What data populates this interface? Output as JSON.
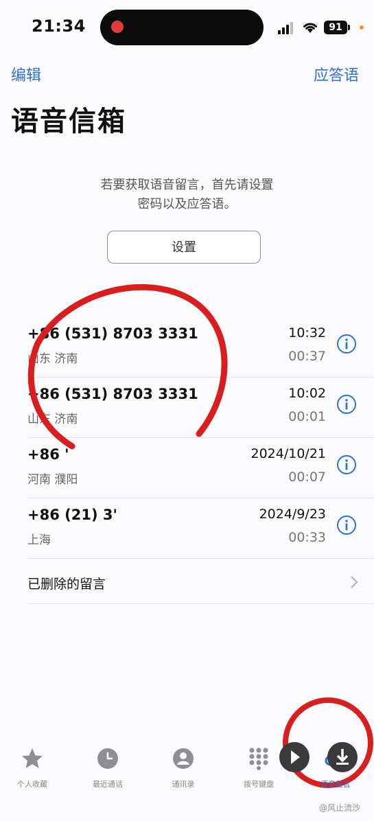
{
  "status": {
    "time": "21:34",
    "battery": "91"
  },
  "nav": {
    "edit": "编辑",
    "greeting": "应答语"
  },
  "title": "语音信箱",
  "prompt": {
    "line1": "若要获取语音留言，首先请设置",
    "line2": "密码以及应答语。"
  },
  "setup_button": "设置",
  "voicemails": [
    {
      "number": "+86 (531) 8703 3331",
      "location": "山东 济南",
      "time": "10:32",
      "duration": "00:37"
    },
    {
      "number": "+86 (531) 8703 3331",
      "location": "山东 济南",
      "time": "10:02",
      "duration": "00:01"
    },
    {
      "number": "+86 '",
      "location": "河南 濮阳",
      "time": "2024/10/21",
      "duration": "00:07"
    },
    {
      "number": "+86 (21) 3'",
      "location": "上海",
      "time": "2024/9/23",
      "duration": "00:33"
    }
  ],
  "deleted_label": "已删除的留言",
  "tabs": [
    {
      "label": "个人收藏",
      "icon": "star-icon"
    },
    {
      "label": "最近通话",
      "icon": "clock-icon"
    },
    {
      "label": "通讯录",
      "icon": "person-icon"
    },
    {
      "label": "拨号键盘",
      "icon": "keypad-icon"
    },
    {
      "label": "语音留言",
      "icon": "voicemail-icon"
    }
  ],
  "watermark": "@风止流沙",
  "colors": {
    "accent": "#2f6fd6",
    "annotation": "#d81e1e"
  }
}
